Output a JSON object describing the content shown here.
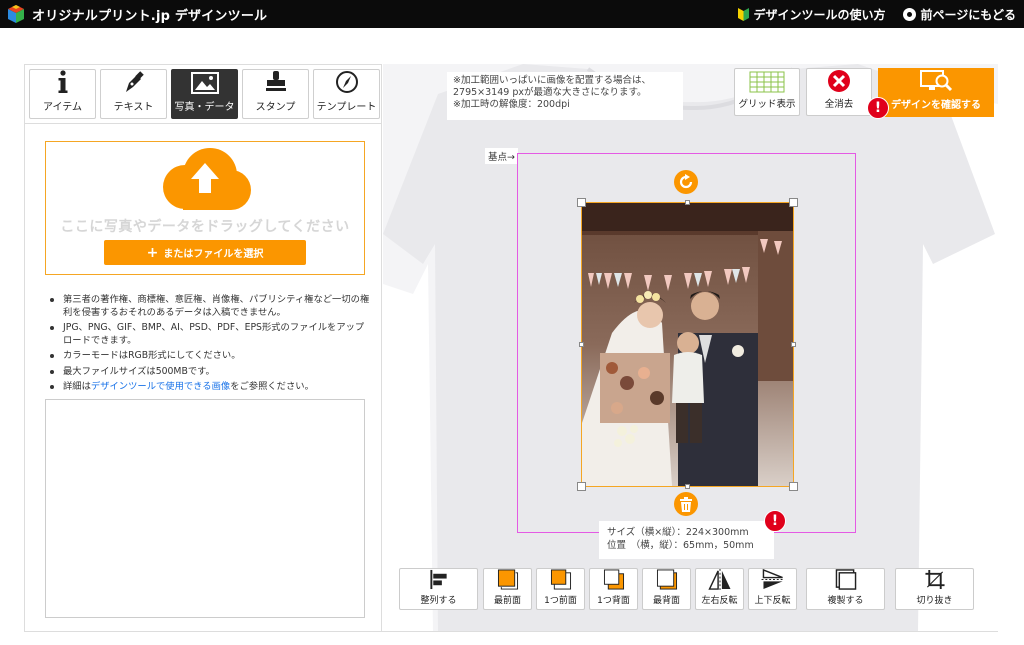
{
  "header": {
    "logo_text": "オリジナルプリント.jp デザインツール",
    "help_link": "デザインツールの使い方",
    "back_link": "前ページにもどる"
  },
  "tabs": [
    {
      "label": "アイテム",
      "icon": "info-icon"
    },
    {
      "label": "テキスト",
      "icon": "pen-icon"
    },
    {
      "label": "写真・データ",
      "icon": "image-icon",
      "active": true
    },
    {
      "label": "スタンプ",
      "icon": "stamp-icon"
    },
    {
      "label": "テンプレート",
      "icon": "compass-icon"
    }
  ],
  "upload": {
    "drop_text": "ここに写真やデータをドラッグしてください",
    "file_button": "またはファイルを選択"
  },
  "notes": {
    "n1": "第三者の著作権、商標権、意匠権、肖像権、パブリシティ権など一切の権利を侵害するおそれのあるデータは入稿できません。",
    "n2": "JPG、PNG、GIF、BMP、AI、PSD、PDF、EPS形式のファイルをアップロードできます。",
    "n3": "カラーモードはRGB形式にしてください。",
    "n4": "最大ファイルサイズは500MBです。",
    "n5_prefix": "詳細は",
    "n5_link": "デザインツールで使用できる画像",
    "n5_suffix": "をご参照ください。"
  },
  "canvas": {
    "note_line1": "※加工範囲いっぱいに画像を配置する場合は、",
    "note_line2": "2795×3149 pxが最適な大きさになります。",
    "note_line3": "※加工時の解像度：200dpi",
    "origin_label": "基点→",
    "size_line": "サイズ（横×縦）：224×300mm",
    "position_line": "位置　（横，縦）：65mm，50mm",
    "alert_mark": "!"
  },
  "toolbar_top": {
    "grid": "グリッド表示",
    "clear": "全消去",
    "confirm": "デザインを確認する"
  },
  "toolbar_bottom": {
    "align": "整列する",
    "front": "最前面",
    "forward": "1つ前面",
    "backward": "1つ背面",
    "back": "最背面",
    "flip_h": "左右反転",
    "flip_v": "上下反転",
    "duplicate": "複製する",
    "crop": "切り抜き"
  },
  "colors": {
    "accent": "#fb9600",
    "header_bg": "#0b0b0b",
    "print_area": "#e45ae4",
    "alert": "#e0001b"
  }
}
